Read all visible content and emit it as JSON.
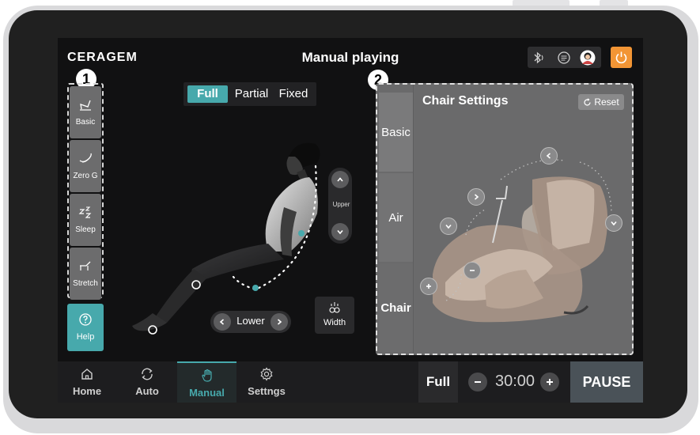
{
  "header": {
    "logo": "CERAGEM",
    "title": "Manual playing",
    "status_icons": [
      "bluetooth-icon",
      "chat-icon",
      "avatar-icon"
    ],
    "power_icon": "power-icon",
    "accent_color": "#f29535"
  },
  "annotations": {
    "badge1": "1",
    "badge2": "2"
  },
  "modes": [
    {
      "label": "Basic",
      "icon": "recliner-icon"
    },
    {
      "label": "Zero G",
      "icon": "zero-gravity-icon"
    },
    {
      "label": "Sleep",
      "icon": "sleep-icon"
    },
    {
      "label": "Stretch",
      "icon": "stretch-icon"
    }
  ],
  "help": {
    "label": "Help",
    "icon": "question-icon"
  },
  "segment": {
    "options": [
      "Full",
      "Partial",
      "Fixed"
    ],
    "selected": "Full"
  },
  "upper": {
    "label": "Upper"
  },
  "lower": {
    "label": "Lower"
  },
  "width": {
    "label": "Width"
  },
  "panel": {
    "title": "Chair Settings",
    "reset_label": "Reset",
    "tabs": [
      "Basic",
      "Air",
      "Chair"
    ],
    "selected_tab": "Chair"
  },
  "nav": [
    {
      "label": "Home",
      "icon": "home-icon"
    },
    {
      "label": "Auto",
      "icon": "auto-icon"
    },
    {
      "label": "Manual",
      "icon": "hand-icon"
    },
    {
      "label": "Settngs",
      "icon": "gear-icon"
    }
  ],
  "nav_selected": "Manual",
  "controls": {
    "intensity": "Full",
    "timer": "30:00",
    "pause_label": "PAUSE"
  },
  "colors": {
    "teal": "#47a9ac",
    "orange": "#f29535"
  }
}
